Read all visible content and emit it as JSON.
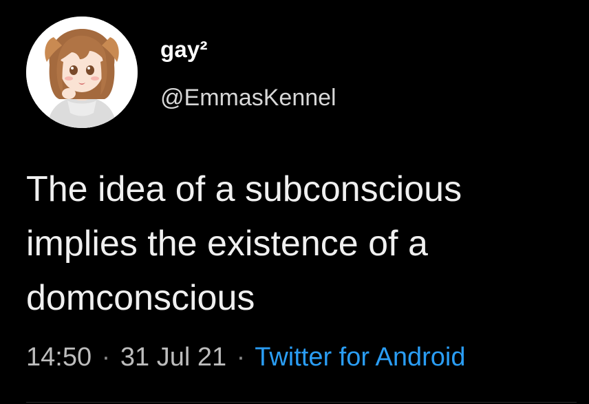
{
  "tweet": {
    "display_name": "gay²",
    "handle": "@EmmasKennel",
    "avatar": "anime-girl-with-dog-ears-avatar",
    "text": "The idea of a subconscious\nimplies the existence of a\ndomconscious",
    "time": "14:50",
    "separator": "·",
    "date": "31 Jul 21",
    "source": "Twitter for Android"
  },
  "colors": {
    "background": "#000000",
    "text": "#f0f0f0",
    "meta": "#bdbdbd",
    "link": "#2a9df4"
  }
}
